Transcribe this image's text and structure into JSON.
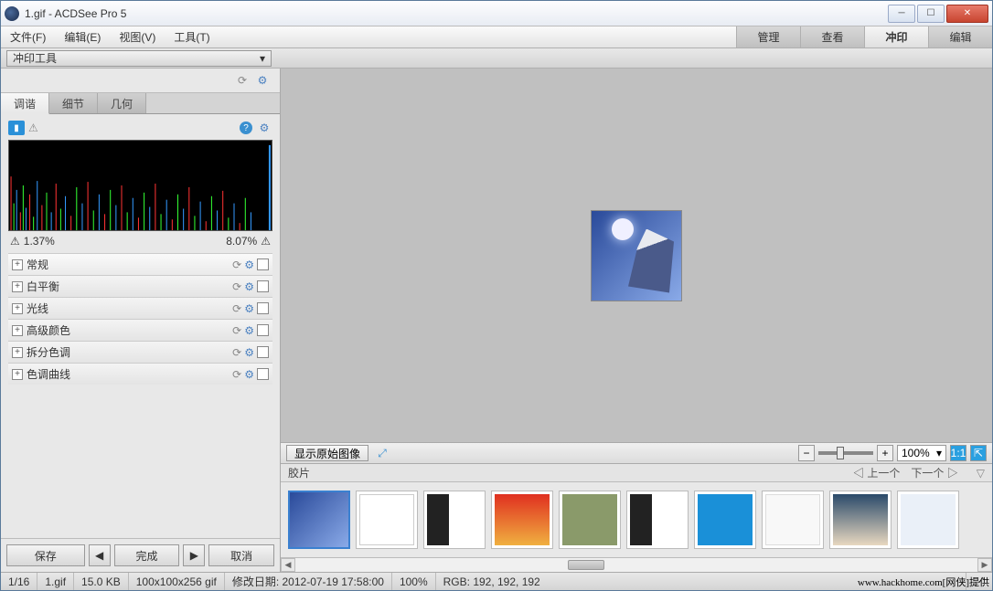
{
  "window": {
    "title": "1.gif - ACDSee Pro 5"
  },
  "menu": {
    "file": "文件(F)",
    "edit": "编辑(E)",
    "view": "视图(V)",
    "tools": "工具(T)"
  },
  "modes": {
    "manage": "管理",
    "view": "查看",
    "develop": "冲印",
    "edit": "编辑"
  },
  "toolstrip": {
    "dropdown": "冲印工具"
  },
  "innerTabs": {
    "tune": "调谐",
    "detail": "细节",
    "geometry": "几何"
  },
  "histogram": {
    "low": "1.37%",
    "high": "8.07%"
  },
  "sections": {
    "general": "常规",
    "whiteBalance": "白平衡",
    "lighting": "光线",
    "advancedColor": "高级颜色",
    "splitTone": "拆分色调",
    "toneCurve": "色调曲线"
  },
  "sideButtons": {
    "save": "保存",
    "done": "完成",
    "cancel": "取消"
  },
  "viewbar": {
    "showOriginal": "显示原始图像",
    "zoom": "100%"
  },
  "filmstrip": {
    "label": "胶片",
    "prev": "上一个",
    "next": "下一个"
  },
  "status": {
    "index": "1/16",
    "filename": "1.gif",
    "filesize": "15.0 KB",
    "dims": "100x100x256 gif",
    "modified": "修改日期: 2012-07-19 17:58:00",
    "zoom": "100%",
    "rgb": "RGB: 192, 192, 192"
  },
  "watermark": "www.hackhome.com[网侠]提供"
}
